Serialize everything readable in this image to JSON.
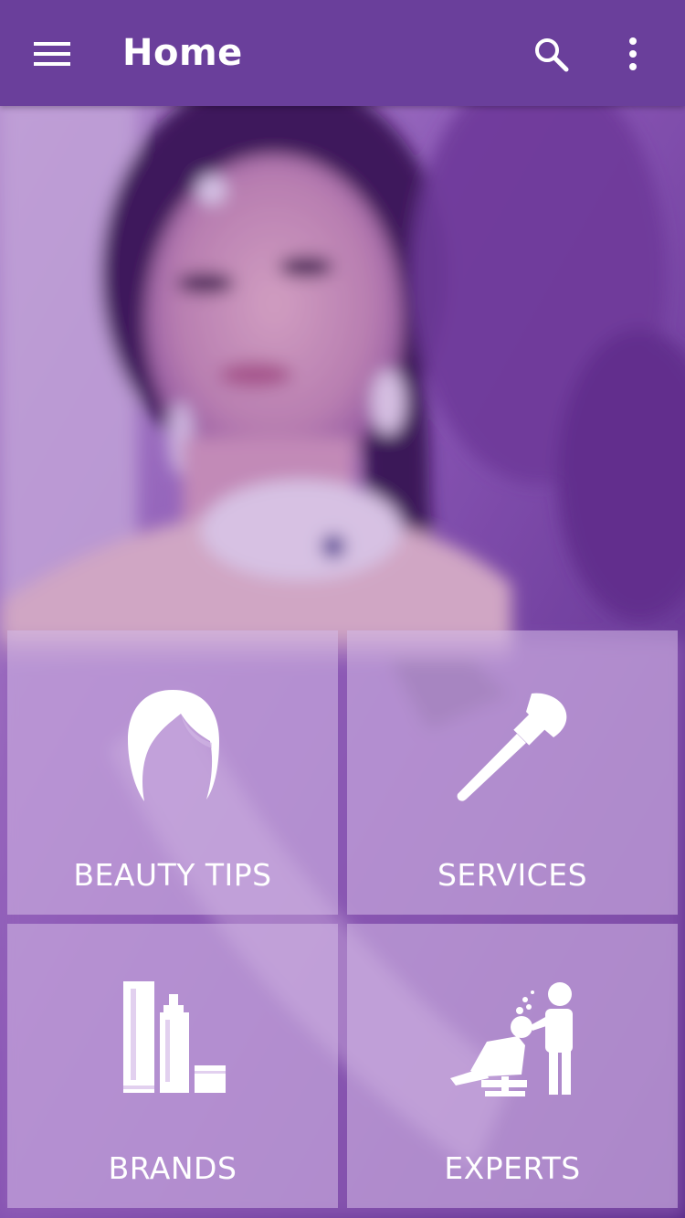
{
  "appbar": {
    "title": "Home",
    "background": "#6a3f9b",
    "menu_icon": "hamburger-menu-icon",
    "search_icon": "search-icon",
    "more_icon": "more-vertical-icon"
  },
  "hero": {
    "description_icon": "woman-portrait-photo",
    "tint": "#7a3fa8"
  },
  "tiles": [
    {
      "label": "BEAUTY TIPS",
      "icon": "hair-icon"
    },
    {
      "label": "SERVICES",
      "icon": "makeup-brush-icon"
    },
    {
      "label": "BRANDS",
      "icon": "cosmetic-bottles-icon"
    },
    {
      "label": "EXPERTS",
      "icon": "salon-chair-stylist-icon"
    }
  ]
}
